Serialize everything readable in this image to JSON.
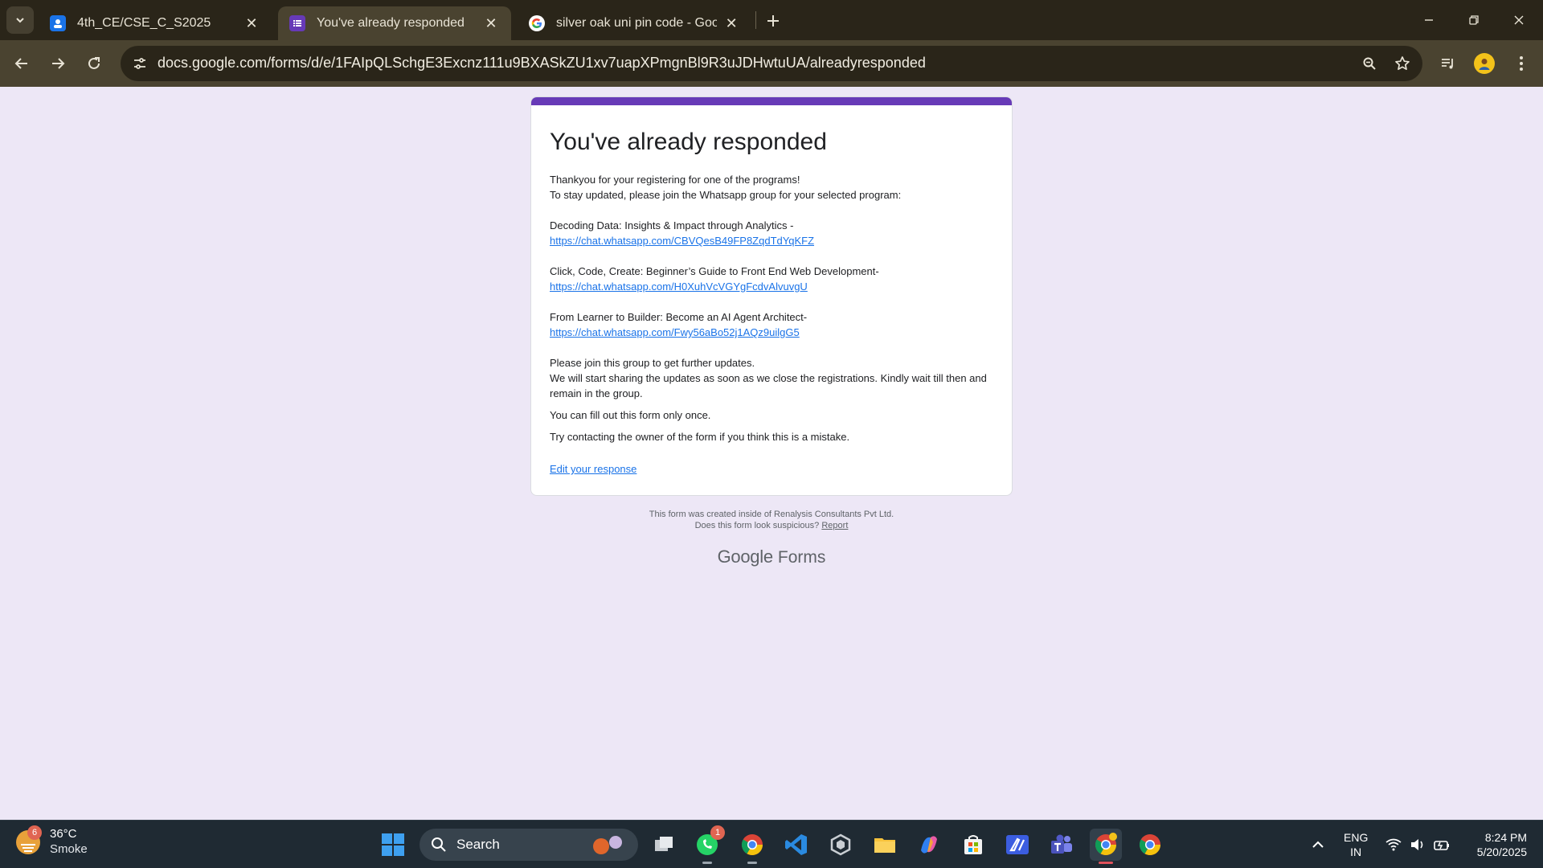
{
  "browser": {
    "tabs": [
      {
        "title": "4th_CE/CSE_C_S2025",
        "icon": "classroom-icon",
        "active": false
      },
      {
        "title": "You've already responded",
        "icon": "google-forms-icon",
        "active": true
      },
      {
        "title": "silver oak uni pin code - Google",
        "icon": "google-icon",
        "active": false
      }
    ],
    "url": "docs.google.com/forms/d/e/1FAIpQLSchgE3Excnz111u9BXASkZU1xv7uapXPmgnBl9R3uJDHwtuUA/alreadyresponded"
  },
  "form": {
    "accent_color": "#673ab7",
    "title": "You've already responded",
    "intro_1": "Thankyou for your registering for one of the programs!",
    "intro_2": "To stay updated, please join the Whatsapp group for your selected program:",
    "programs": [
      {
        "name": "Decoding Data: Insights & Impact through Analytics -",
        "link": "https://chat.whatsapp.com/CBVQesB49FP8ZqdTdYqKFZ"
      },
      {
        "name": "Click, Code, Create: Beginner’s Guide to Front End Web Development-",
        "link": "https://chat.whatsapp.com/H0XuhVcVGYgFcdvAlvuvgU"
      },
      {
        "name": "From Learner to Builder: Become an AI Agent Architect-",
        "link": "https://chat.whatsapp.com/Fwy56aBo52j1AQz9uilgG5"
      }
    ],
    "outro_1": "Please join this group to get further updates.",
    "outro_2": "We will start sharing the updates as soon as we close the registrations. Kindly wait till then and remain in the group.",
    "once_note": "You can fill out this form only once.",
    "contact_note": "Try contacting the owner of the form if you think this is a mistake.",
    "edit_link": "Edit your response"
  },
  "footer": {
    "created_by": "This form was created inside of Renalysis Consultants Pvt Ltd.",
    "suspicious": "Does this form look suspicious?",
    "report": "Report",
    "brand_google": "Google",
    "brand_forms": "Forms"
  },
  "taskbar": {
    "weather_temp": "36°C",
    "weather_desc": "Smoke",
    "weather_badge": "6",
    "search_label": "Search",
    "whatsapp_badge": "1",
    "lang_1": "ENG",
    "lang_2": "IN",
    "time": "8:24 PM",
    "date": "5/20/2025"
  }
}
